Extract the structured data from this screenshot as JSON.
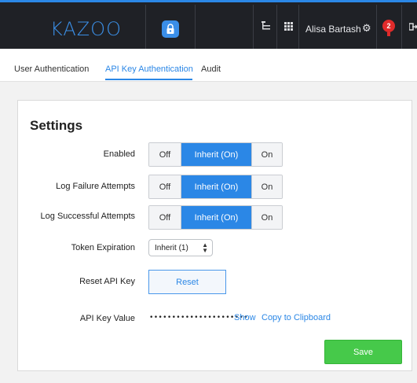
{
  "header": {
    "logo": "KAZOO",
    "user_name": "Alisa Bartash",
    "notification_count": "2",
    "icons": {
      "app": "lock-icon",
      "tree": "tree-icon",
      "apps": "grid-icon",
      "settings": "gear-icon",
      "notifications": "bell-icon",
      "logout": "exit-icon"
    }
  },
  "tabs": [
    {
      "label": "User Authentication"
    },
    {
      "label": "API Key Authentication",
      "active": true
    },
    {
      "label": "Audit"
    }
  ],
  "settings": {
    "title": "Settings",
    "rows": [
      {
        "label": "Enabled",
        "options": [
          "Off",
          "Inherit (On)",
          "On"
        ],
        "selected": "Inherit (On)"
      },
      {
        "label": "Log Failure Attempts",
        "options": [
          "Off",
          "Inherit (On)",
          "On"
        ],
        "selected": "Inherit (On)"
      },
      {
        "label": "Log Successful Attempts",
        "options": [
          "Off",
          "Inherit (On)",
          "On"
        ],
        "selected": "Inherit (On)"
      }
    ],
    "token_expiration": {
      "label": "Token Expiration",
      "value": "Inherit (1)"
    },
    "reset": {
      "label": "Reset API Key",
      "button": "Reset"
    },
    "api_key": {
      "label": "API Key Value",
      "masked": "••••••••••••••••••••••",
      "show": "Show",
      "copy": "Copy to Clipboard"
    },
    "save": "Save"
  },
  "colors": {
    "accent": "#2b87e6",
    "topbar": "#1f2126",
    "save": "#46c94a",
    "badge": "#e02b2b"
  }
}
